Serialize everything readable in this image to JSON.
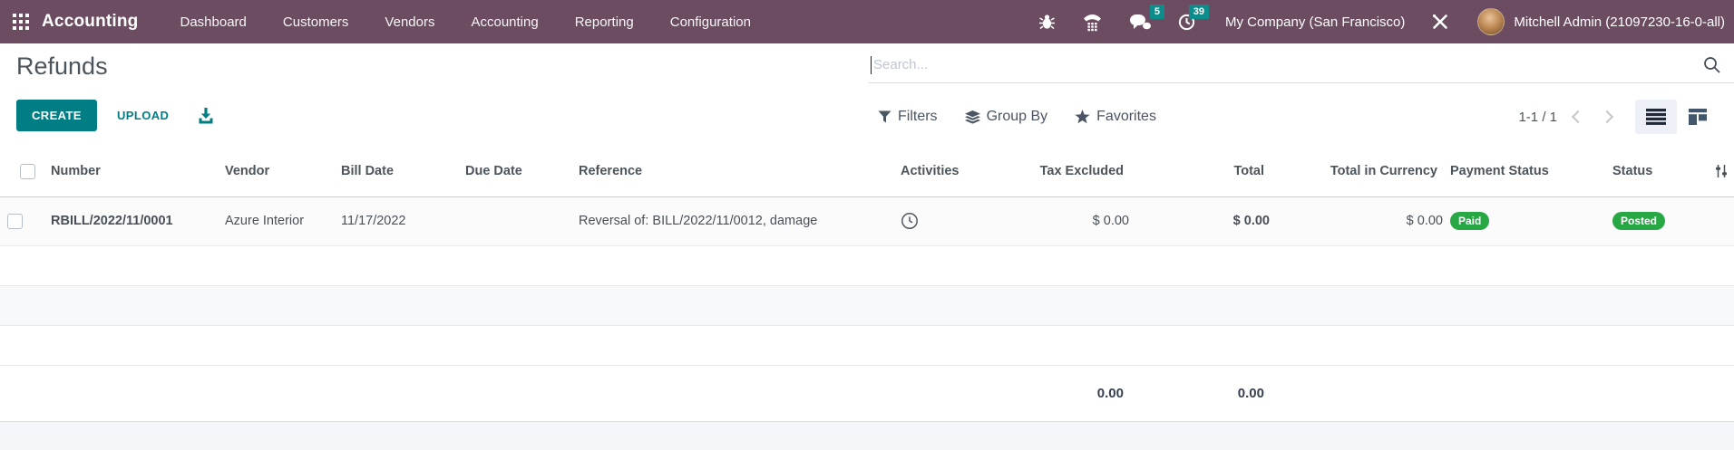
{
  "topbar": {
    "app_name": "Accounting",
    "menu": [
      "Dashboard",
      "Customers",
      "Vendors",
      "Accounting",
      "Reporting",
      "Configuration"
    ],
    "messages_count": "5",
    "activities_count": "39",
    "company": "My Company (San Francisco)",
    "user": "Mitchell Admin (21097230-16-0-all)"
  },
  "control_panel": {
    "title": "Refunds",
    "create_label": "CREATE",
    "upload_label": "UPLOAD",
    "search_placeholder": "Search...",
    "filters_label": "Filters",
    "group_by_label": "Group By",
    "favorites_label": "Favorites",
    "pager": "1-1 / 1"
  },
  "table": {
    "columns": [
      "Number",
      "Vendor",
      "Bill Date",
      "Due Date",
      "Reference",
      "Activities",
      "Tax Excluded",
      "Total",
      "Total in Currency",
      "Payment Status",
      "Status"
    ],
    "rows": [
      {
        "number": "RBILL/2022/11/0001",
        "vendor": "Azure Interior",
        "bill_date": "11/17/2022",
        "due_date": "",
        "reference": "Reversal of: BILL/2022/11/0012, damage",
        "tax_excluded": "$ 0.00",
        "total": "$ 0.00",
        "total_in_currency": "$ 0.00",
        "payment_status": "Paid",
        "status": "Posted"
      }
    ],
    "totals": {
      "tax_excluded": "0.00",
      "total": "0.00"
    }
  },
  "icons": {
    "apps": "grid-3x3",
    "debug": "bug",
    "voip": "phone-dialpad",
    "messages": "chat-bubbles",
    "activities": "clock",
    "tools": "crossed-tools",
    "search": "magnifier",
    "download": "download-tray",
    "filters": "funnel",
    "group_by": "layers",
    "favorites": "star",
    "list_view": "list-lines",
    "kanban_view": "kanban-blocks",
    "row_activity": "clock-outline",
    "column_options": "sliders"
  },
  "colors": {
    "topbar": "#6b4c60",
    "accent_teal": "#017e84",
    "badge_teal": "#0c8d8b",
    "success_green": "#28a745"
  }
}
